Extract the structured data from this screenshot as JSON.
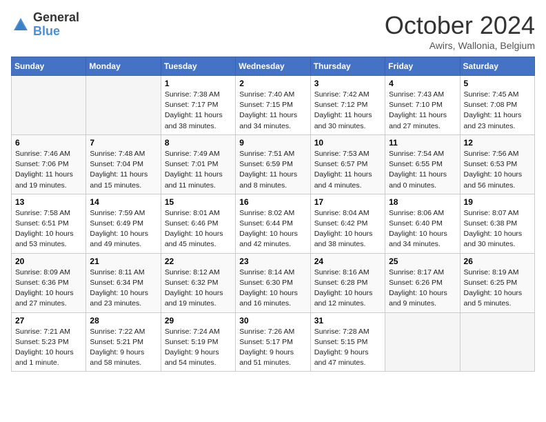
{
  "logo": {
    "general": "General",
    "blue": "Blue"
  },
  "title": "October 2024",
  "location": "Awirs, Wallonia, Belgium",
  "weekdays": [
    "Sunday",
    "Monday",
    "Tuesday",
    "Wednesday",
    "Thursday",
    "Friday",
    "Saturday"
  ],
  "weeks": [
    [
      {
        "day": "",
        "info": ""
      },
      {
        "day": "",
        "info": ""
      },
      {
        "day": "1",
        "info": "Sunrise: 7:38 AM\nSunset: 7:17 PM\nDaylight: 11 hours and 38 minutes."
      },
      {
        "day": "2",
        "info": "Sunrise: 7:40 AM\nSunset: 7:15 PM\nDaylight: 11 hours and 34 minutes."
      },
      {
        "day": "3",
        "info": "Sunrise: 7:42 AM\nSunset: 7:12 PM\nDaylight: 11 hours and 30 minutes."
      },
      {
        "day": "4",
        "info": "Sunrise: 7:43 AM\nSunset: 7:10 PM\nDaylight: 11 hours and 27 minutes."
      },
      {
        "day": "5",
        "info": "Sunrise: 7:45 AM\nSunset: 7:08 PM\nDaylight: 11 hours and 23 minutes."
      }
    ],
    [
      {
        "day": "6",
        "info": "Sunrise: 7:46 AM\nSunset: 7:06 PM\nDaylight: 11 hours and 19 minutes."
      },
      {
        "day": "7",
        "info": "Sunrise: 7:48 AM\nSunset: 7:04 PM\nDaylight: 11 hours and 15 minutes."
      },
      {
        "day": "8",
        "info": "Sunrise: 7:49 AM\nSunset: 7:01 PM\nDaylight: 11 hours and 11 minutes."
      },
      {
        "day": "9",
        "info": "Sunrise: 7:51 AM\nSunset: 6:59 PM\nDaylight: 11 hours and 8 minutes."
      },
      {
        "day": "10",
        "info": "Sunrise: 7:53 AM\nSunset: 6:57 PM\nDaylight: 11 hours and 4 minutes."
      },
      {
        "day": "11",
        "info": "Sunrise: 7:54 AM\nSunset: 6:55 PM\nDaylight: 11 hours and 0 minutes."
      },
      {
        "day": "12",
        "info": "Sunrise: 7:56 AM\nSunset: 6:53 PM\nDaylight: 10 hours and 56 minutes."
      }
    ],
    [
      {
        "day": "13",
        "info": "Sunrise: 7:58 AM\nSunset: 6:51 PM\nDaylight: 10 hours and 53 minutes."
      },
      {
        "day": "14",
        "info": "Sunrise: 7:59 AM\nSunset: 6:49 PM\nDaylight: 10 hours and 49 minutes."
      },
      {
        "day": "15",
        "info": "Sunrise: 8:01 AM\nSunset: 6:46 PM\nDaylight: 10 hours and 45 minutes."
      },
      {
        "day": "16",
        "info": "Sunrise: 8:02 AM\nSunset: 6:44 PM\nDaylight: 10 hours and 42 minutes."
      },
      {
        "day": "17",
        "info": "Sunrise: 8:04 AM\nSunset: 6:42 PM\nDaylight: 10 hours and 38 minutes."
      },
      {
        "day": "18",
        "info": "Sunrise: 8:06 AM\nSunset: 6:40 PM\nDaylight: 10 hours and 34 minutes."
      },
      {
        "day": "19",
        "info": "Sunrise: 8:07 AM\nSunset: 6:38 PM\nDaylight: 10 hours and 30 minutes."
      }
    ],
    [
      {
        "day": "20",
        "info": "Sunrise: 8:09 AM\nSunset: 6:36 PM\nDaylight: 10 hours and 27 minutes."
      },
      {
        "day": "21",
        "info": "Sunrise: 8:11 AM\nSunset: 6:34 PM\nDaylight: 10 hours and 23 minutes."
      },
      {
        "day": "22",
        "info": "Sunrise: 8:12 AM\nSunset: 6:32 PM\nDaylight: 10 hours and 19 minutes."
      },
      {
        "day": "23",
        "info": "Sunrise: 8:14 AM\nSunset: 6:30 PM\nDaylight: 10 hours and 16 minutes."
      },
      {
        "day": "24",
        "info": "Sunrise: 8:16 AM\nSunset: 6:28 PM\nDaylight: 10 hours and 12 minutes."
      },
      {
        "day": "25",
        "info": "Sunrise: 8:17 AM\nSunset: 6:26 PM\nDaylight: 10 hours and 9 minutes."
      },
      {
        "day": "26",
        "info": "Sunrise: 8:19 AM\nSunset: 6:25 PM\nDaylight: 10 hours and 5 minutes."
      }
    ],
    [
      {
        "day": "27",
        "info": "Sunrise: 7:21 AM\nSunset: 5:23 PM\nDaylight: 10 hours and 1 minute."
      },
      {
        "day": "28",
        "info": "Sunrise: 7:22 AM\nSunset: 5:21 PM\nDaylight: 9 hours and 58 minutes."
      },
      {
        "day": "29",
        "info": "Sunrise: 7:24 AM\nSunset: 5:19 PM\nDaylight: 9 hours and 54 minutes."
      },
      {
        "day": "30",
        "info": "Sunrise: 7:26 AM\nSunset: 5:17 PM\nDaylight: 9 hours and 51 minutes."
      },
      {
        "day": "31",
        "info": "Sunrise: 7:28 AM\nSunset: 5:15 PM\nDaylight: 9 hours and 47 minutes."
      },
      {
        "day": "",
        "info": ""
      },
      {
        "day": "",
        "info": ""
      }
    ]
  ]
}
